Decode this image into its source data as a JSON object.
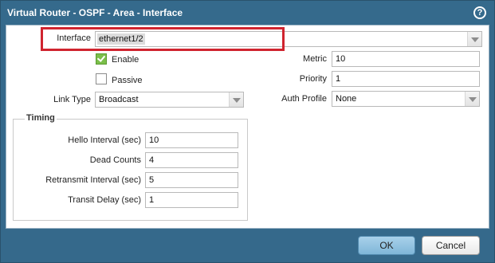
{
  "dialog": {
    "title": "Virtual Router - OSPF - Area - Interface",
    "help_icon": "help-icon",
    "help_glyph": "?"
  },
  "form": {
    "interface": {
      "label": "Interface",
      "value": "ethernet1/2"
    },
    "enable": {
      "label": "Enable",
      "checked": true
    },
    "passive": {
      "label": "Passive",
      "checked": false
    },
    "link_type": {
      "label": "Link Type",
      "value": "Broadcast"
    },
    "metric": {
      "label": "Metric",
      "value": "10"
    },
    "priority": {
      "label": "Priority",
      "value": "1"
    },
    "auth_profile": {
      "label": "Auth Profile",
      "value": "None"
    }
  },
  "timing": {
    "legend": "Timing",
    "hello_interval": {
      "label": "Hello Interval (sec)",
      "value": "10"
    },
    "dead_counts": {
      "label": "Dead Counts",
      "value": "4"
    },
    "retransmit_interval": {
      "label": "Retransmit Interval (sec)",
      "value": "5"
    },
    "transit_delay": {
      "label": "Transit Delay (sec)",
      "value": "1"
    }
  },
  "buttons": {
    "ok": "OK",
    "cancel": "Cancel"
  },
  "colors": {
    "highlight": "#d0242f",
    "title_bar": "#356a8c",
    "checkbox_checked": "#7bbf4a"
  }
}
